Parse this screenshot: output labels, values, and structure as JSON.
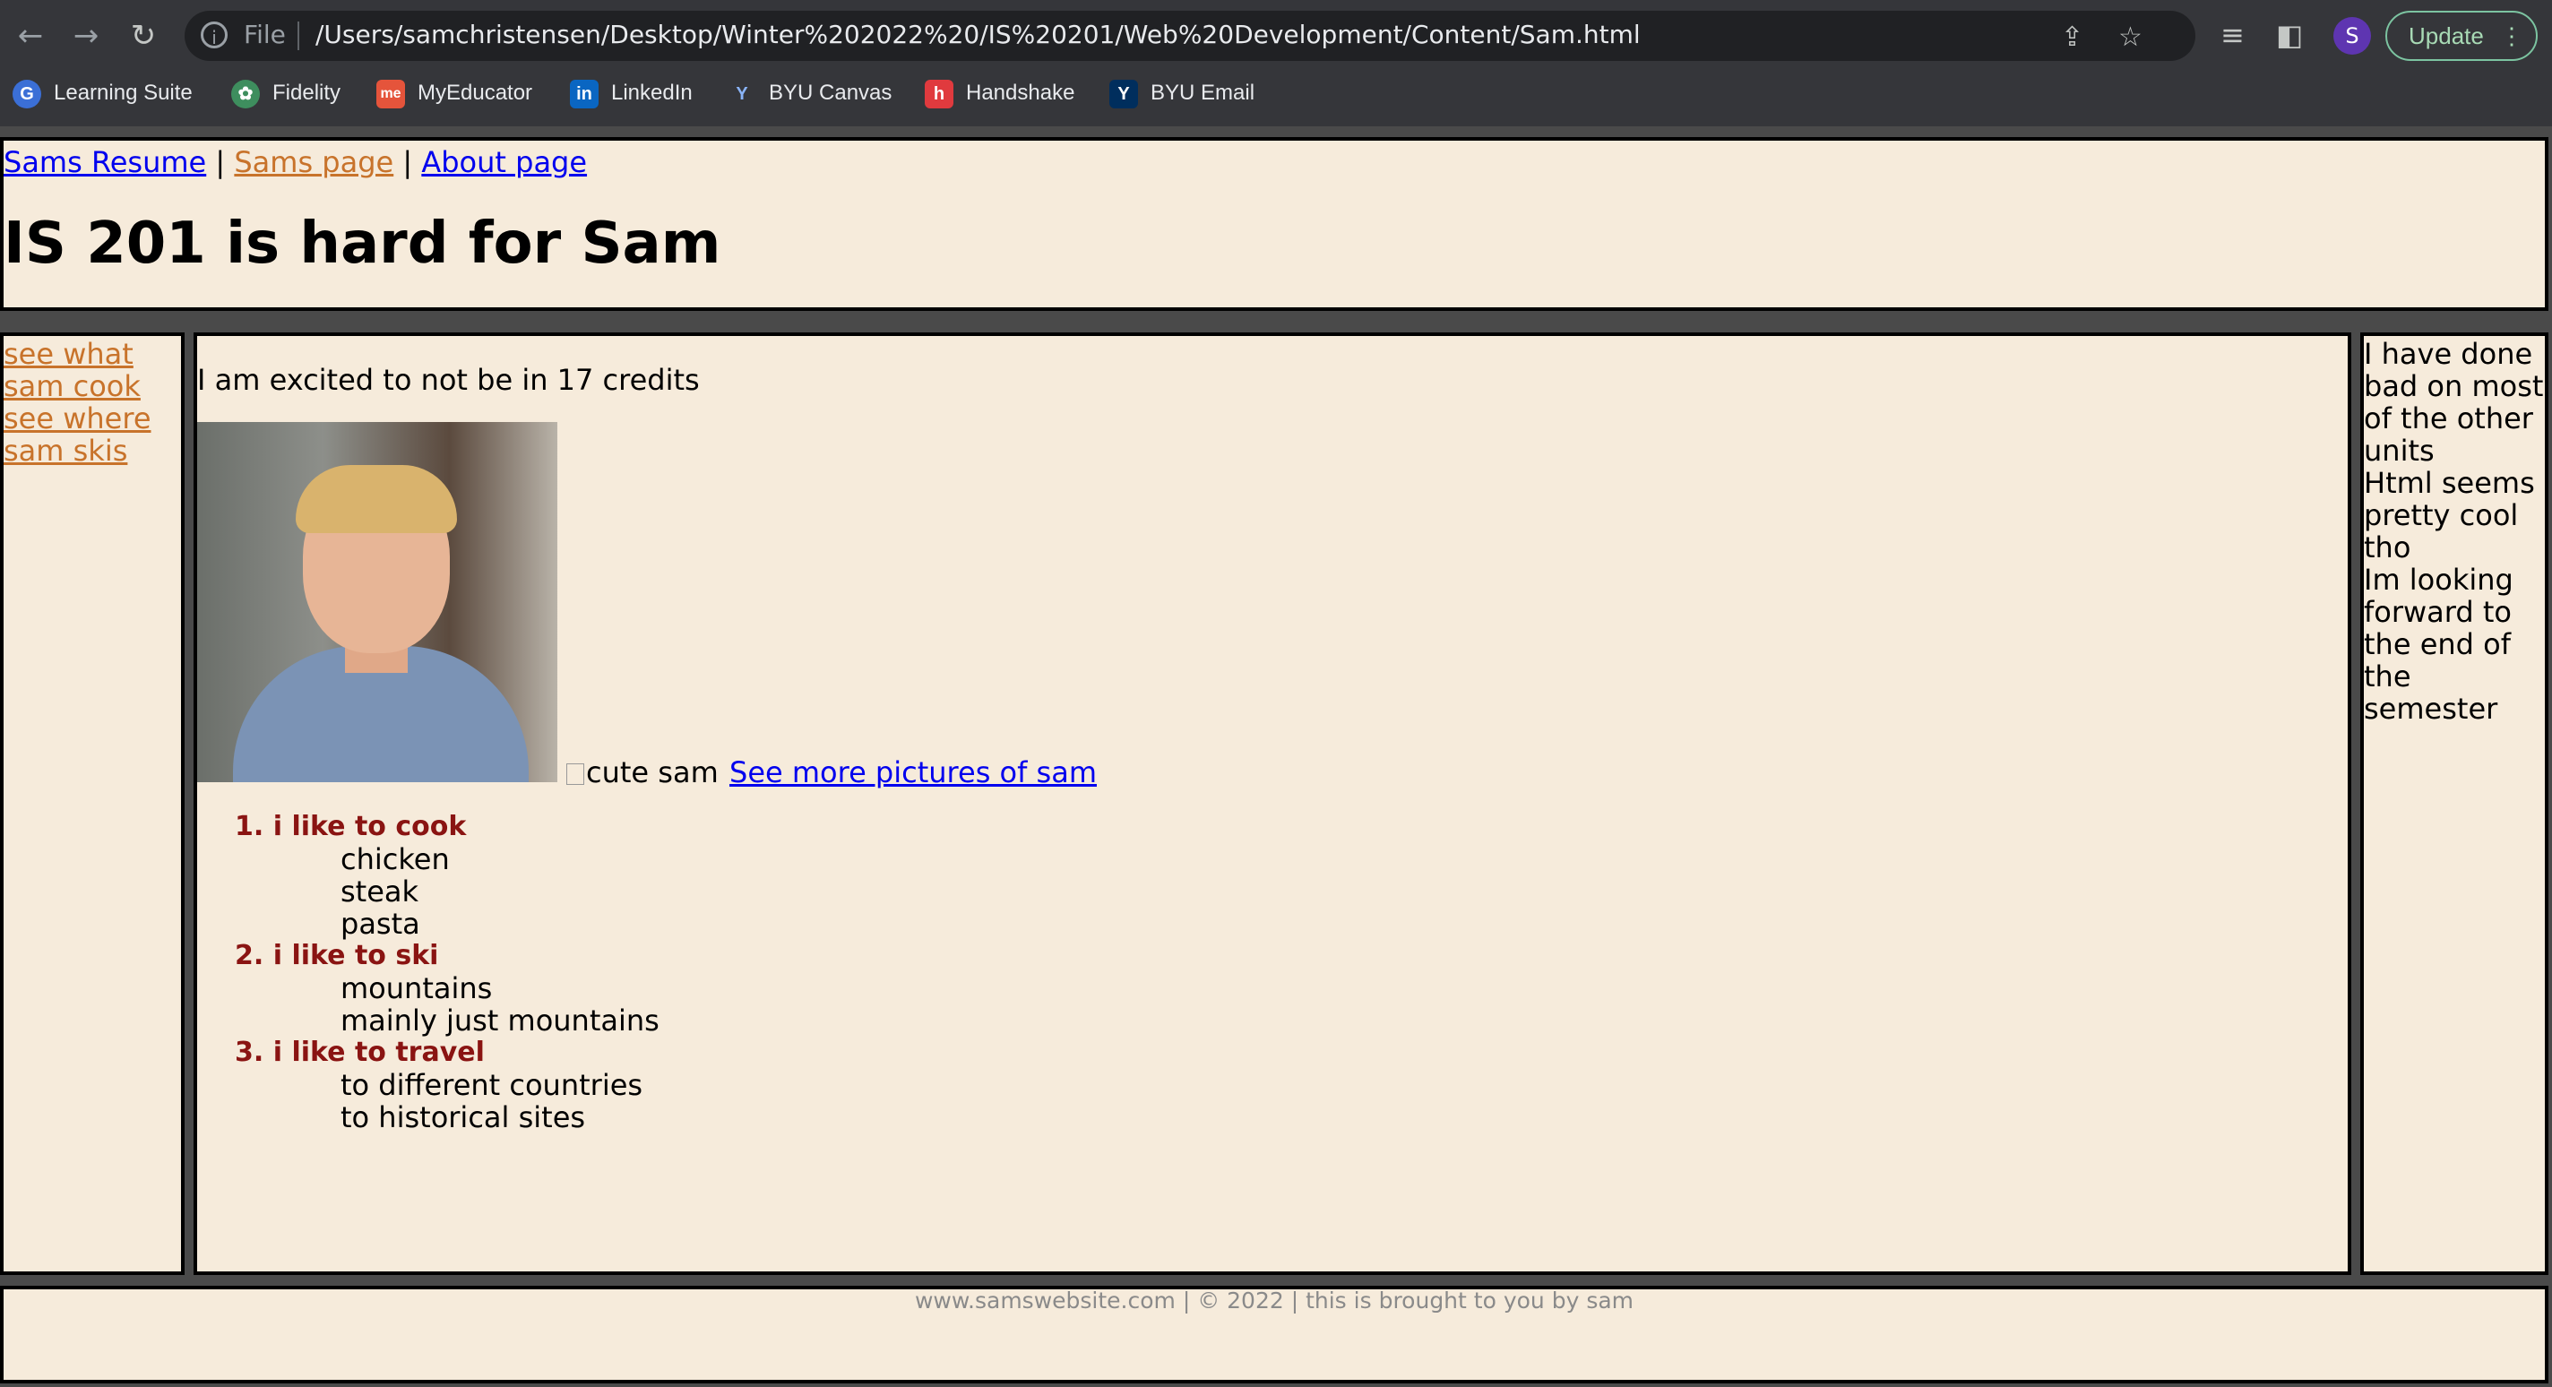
{
  "browser": {
    "file_label": "File",
    "url": "/Users/samchristensen/Desktop/Winter%202022%20/IS%20201/Web%20Development/Content/Sam.html",
    "profile_initial": "S",
    "update_label": "Update",
    "bookmarks": [
      {
        "label": "Learning Suite",
        "icon": "learning-suite-icon",
        "color": "#3b6fd6"
      },
      {
        "label": "Fidelity",
        "icon": "fidelity-icon",
        "color": "#3e8e5e"
      },
      {
        "label": "MyEducator",
        "icon": "myeducator-icon",
        "color": "#e5543b"
      },
      {
        "label": "LinkedIn",
        "icon": "linkedin-icon",
        "color": "#0a66c2"
      },
      {
        "label": "BYU Canvas",
        "icon": "byu-canvas-icon",
        "color": "#35363a"
      },
      {
        "label": "Handshake",
        "icon": "handshake-icon",
        "color": "#e03a3e"
      },
      {
        "label": "BYU Email",
        "icon": "byu-email-icon",
        "color": "#002e5d"
      }
    ]
  },
  "header": {
    "nav": [
      {
        "label": "Sams Resume"
      },
      {
        "label": "Sams page"
      },
      {
        "label": "About page"
      }
    ],
    "separator": "|",
    "title": "IS 201 is hard for Sam"
  },
  "left_sidebar": {
    "links": [
      "see what sam cook",
      "see where sam skis"
    ]
  },
  "main": {
    "intro": "I am excited to not be in 17 credits",
    "broken_image_alt": "cute sam",
    "more_pictures_link": "See more pictures of sam",
    "list": [
      {
        "title": "1. i like to cook",
        "items": [
          "chicken",
          "steak",
          "pasta"
        ]
      },
      {
        "title": "2. i like to ski",
        "items": [
          "mountains",
          "mainly just mountains"
        ]
      },
      {
        "title": "3. i like to travel",
        "items": [
          "to different countries",
          "to historical sites"
        ]
      }
    ]
  },
  "right_sidebar": {
    "paragraphs": [
      "I have done bad on most of the other units",
      "Html seems pretty cool tho",
      "Im looking forward to the end of the semester"
    ]
  },
  "footer": {
    "text": "www.samswebsite.com | © 2022 | this is brought to you by sam"
  },
  "colors": {
    "page_bg": "#f6ebdb",
    "link": "#0000ee",
    "visited_link": "#c8732b",
    "list_title": "#8a1412",
    "footer_text": "#8a8a8a"
  }
}
